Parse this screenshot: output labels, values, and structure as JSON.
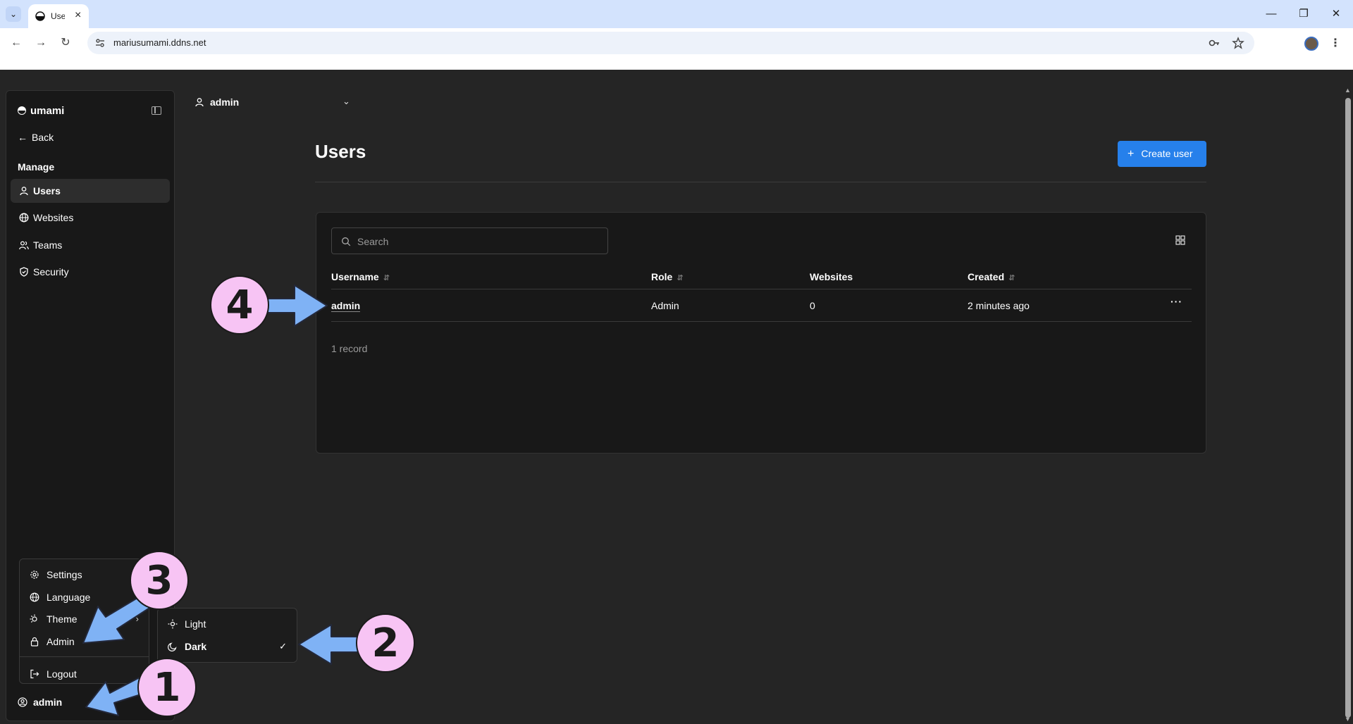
{
  "browser": {
    "tab_title": "Users",
    "url": "mariusumami.ddns.net"
  },
  "sidebar": {
    "brand": "umami",
    "back_label": "Back",
    "section_label": "Manage",
    "items": [
      {
        "label": "Users",
        "icon": "user-icon",
        "active": true
      },
      {
        "label": "Websites",
        "icon": "globe-icon",
        "active": false
      },
      {
        "label": "Teams",
        "icon": "users-icon",
        "active": false
      },
      {
        "label": "Security",
        "icon": "shield-icon",
        "active": false
      }
    ],
    "user_label": "admin"
  },
  "user_menu": {
    "items": [
      {
        "label": "Settings",
        "icon": "gear-icon"
      },
      {
        "label": "Language",
        "icon": "globe-icon"
      },
      {
        "label": "Theme",
        "icon": "theme-icon"
      },
      {
        "label": "Admin",
        "icon": "lock-icon"
      },
      {
        "label": "Logout",
        "icon": "logout-icon"
      }
    ]
  },
  "theme_menu": {
    "items": [
      {
        "label": "Light",
        "icon": "sun-icon",
        "selected": false
      },
      {
        "label": "Dark",
        "icon": "moon-icon",
        "selected": true
      }
    ]
  },
  "header": {
    "account": "admin"
  },
  "main": {
    "title": "Users",
    "create_button": "Create user",
    "search_placeholder": "Search",
    "columns": [
      "Username",
      "Role",
      "Websites",
      "Created"
    ],
    "rows": [
      {
        "username": "admin",
        "role": "Admin",
        "websites": "0",
        "created": "2 minutes ago"
      }
    ],
    "record_count": "1 record"
  },
  "annotations": [
    "1",
    "2",
    "3",
    "4"
  ],
  "colors": {
    "accent": "#2680eb",
    "badge": "#f7c4f4",
    "arrow": "#7fb2f5",
    "background": "#252525"
  }
}
